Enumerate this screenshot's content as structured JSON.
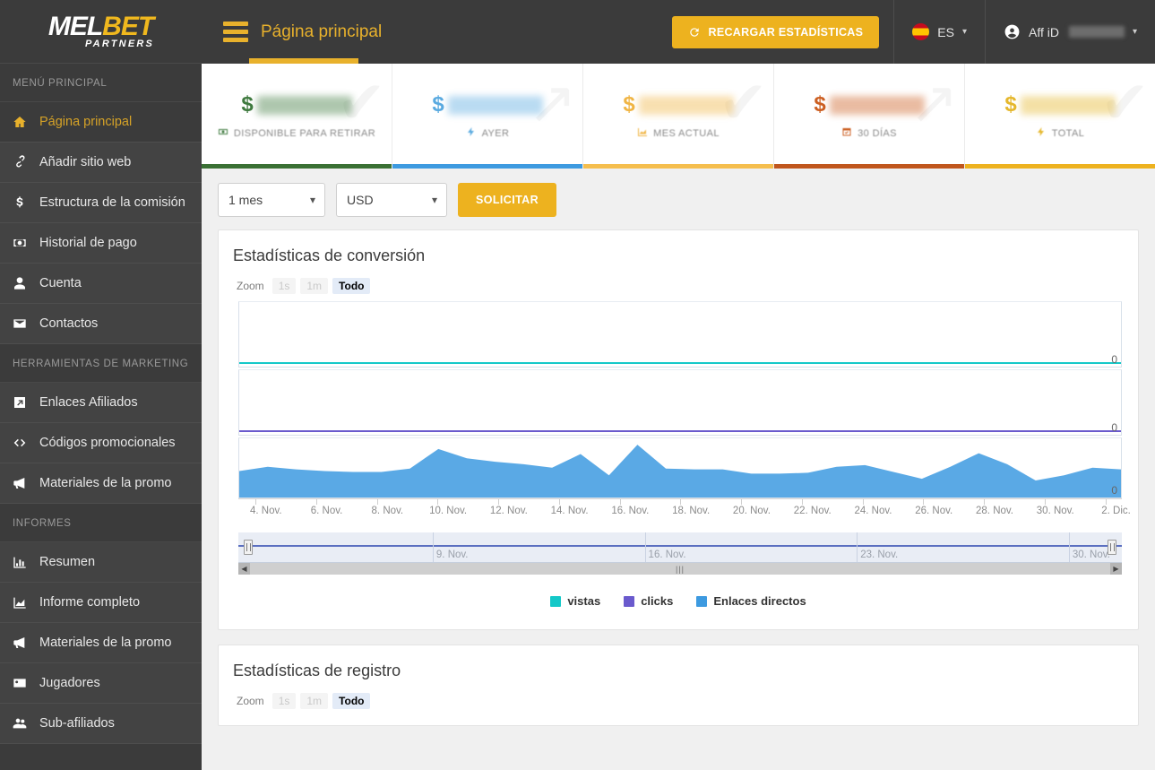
{
  "brand": {
    "logo_main_light": "MEL",
    "logo_main_accent": "BET",
    "logo_sub": "PARTNERS",
    "accent": "#e8b12c"
  },
  "sidebar": {
    "sections": [
      {
        "heading": "MENÚ PRINCIPAL",
        "items": [
          {
            "label": "Página principal",
            "icon": "home-icon",
            "active": true
          },
          {
            "label": "Añadir sitio web",
            "icon": "link-icon",
            "active": false
          },
          {
            "label": "Estructura de la comisión",
            "icon": "dollar-icon",
            "active": false
          },
          {
            "label": "Historial de pago",
            "icon": "money-icon",
            "active": false
          },
          {
            "label": "Cuenta",
            "icon": "user-icon",
            "active": false
          },
          {
            "label": "Contactos",
            "icon": "envelope-icon",
            "active": false
          }
        ]
      },
      {
        "heading": "HERRAMIENTAS DE MARKETING",
        "items": [
          {
            "label": "Enlaces Afiliados",
            "icon": "external-link-icon",
            "active": false
          },
          {
            "label": "Códigos promocionales",
            "icon": "code-icon",
            "active": false
          },
          {
            "label": "Materiales de la promo",
            "icon": "megaphone-icon",
            "active": false
          }
        ]
      },
      {
        "heading": "INFORMES",
        "items": [
          {
            "label": "Resumen",
            "icon": "bar-chart-icon",
            "active": false
          },
          {
            "label": "Informe completo",
            "icon": "area-chart-icon",
            "active": false
          },
          {
            "label": "Materiales de la promo",
            "icon": "megaphone-icon",
            "active": false
          },
          {
            "label": "Jugadores",
            "icon": "id-card-icon",
            "active": false
          },
          {
            "label": "Sub-afiliados",
            "icon": "users-icon",
            "active": false
          }
        ]
      }
    ]
  },
  "topbar": {
    "title": "Página principal",
    "reload_label": "RECARGAR ESTADÍSTICAS",
    "language": "ES",
    "account_label": "Aff iD",
    "account_value_redacted": true
  },
  "cards": [
    {
      "currency": "$",
      "value_redacted": true,
      "label": "DISPONIBLE PARA RETIRAR",
      "icon": "money-bill-icon",
      "color": "#3f7a3f",
      "bar": "#3a7034"
    },
    {
      "currency": "$",
      "value_redacted": true,
      "label": "AYER",
      "icon": "bolt-icon",
      "color": "#5aaae0",
      "bar": "#3d9ae0"
    },
    {
      "currency": "$",
      "value_redacted": true,
      "label": "MES ACTUAL",
      "icon": "chart-icon",
      "color": "#f0b545",
      "bar": "#f5be4e"
    },
    {
      "currency": "$",
      "value_redacted": true,
      "label": "30 DÍAS",
      "icon": "calendar-check-icon",
      "color": "#cc5f22",
      "bar": "#c0561d"
    },
    {
      "currency": "$",
      "value_redacted": true,
      "label": "TOTAL",
      "icon": "bolt-icon",
      "color": "#e5b72c",
      "bar": "#edb21f"
    }
  ],
  "filters": {
    "period": {
      "value": "1 mes",
      "options": [
        "1 mes"
      ]
    },
    "currency": {
      "value": "USD",
      "options": [
        "USD"
      ]
    },
    "submit_label": "SOLICITAR"
  },
  "panels": [
    {
      "title": "Estadísticas de conversión",
      "zoom": {
        "label": "Zoom",
        "buttons": [
          {
            "label": "1s",
            "selected": false
          },
          {
            "label": "1m",
            "selected": false
          },
          {
            "label": "Todo",
            "selected": true
          }
        ]
      }
    },
    {
      "title": "Estadísticas de registro",
      "zoom": {
        "label": "Zoom",
        "buttons": [
          {
            "label": "1s",
            "selected": false
          },
          {
            "label": "1m",
            "selected": false
          },
          {
            "label": "Todo",
            "selected": true
          }
        ]
      }
    }
  ],
  "legend": [
    {
      "label": "vistas",
      "color": "#14c8c8"
    },
    {
      "label": "clicks",
      "color": "#6a5acd"
    },
    {
      "label": "Enlaces directos",
      "color": "#3d9ae0"
    }
  ],
  "navigator": {
    "labels": [
      "9. Nov.",
      "16. Nov.",
      "23. Nov.",
      "30. Nov."
    ],
    "left_arrow": "◀",
    "right_arrow": "▶"
  },
  "chart_data": {
    "type": "area",
    "title": "Estadísticas de conversión",
    "xlabel": "",
    "ylabel": "",
    "grid": true,
    "legend_position": "bottom",
    "x_tick_labels": [
      "4. Nov.",
      "6. Nov.",
      "8. Nov.",
      "10. Nov.",
      "12. Nov.",
      "14. Nov.",
      "16. Nov.",
      "18. Nov.",
      "20. Nov.",
      "22. Nov.",
      "24. Nov.",
      "26. Nov.",
      "28. Nov.",
      "30. Nov.",
      "2. Dic."
    ],
    "y_axis_labels": [
      "0",
      "0",
      "0"
    ],
    "ylim": [
      0,
      1
    ],
    "panels": [
      {
        "name": "vistas",
        "color": "#14c8c8",
        "values_flat_at": 0,
        "note": "flat line at baseline"
      },
      {
        "name": "clicks",
        "color": "#6a5acd",
        "values_flat_at": 0,
        "note": "flat line at baseline"
      },
      {
        "name": "Enlaces directos",
        "color": "#3d9ae0",
        "note": "filled area series"
      }
    ],
    "x": [
      "3. Nov.",
      "4. Nov.",
      "5. Nov.",
      "6. Nov.",
      "7. Nov.",
      "8. Nov.",
      "9. Nov.",
      "10. Nov.",
      "11. Nov.",
      "12. Nov.",
      "13. Nov.",
      "14. Nov.",
      "15. Nov.",
      "16. Nov.",
      "17. Nov.",
      "18. Nov.",
      "19. Nov.",
      "20. Nov.",
      "21. Nov.",
      "22. Nov.",
      "23. Nov.",
      "24. Nov.",
      "25. Nov.",
      "26. Nov.",
      "27. Nov.",
      "28. Nov.",
      "29. Nov.",
      "30. Nov.",
      "1. Dic.",
      "2. Dic."
    ],
    "series": [
      {
        "name": "vistas",
        "color": "#14c8c8",
        "values": [
          0,
          0,
          0,
          0,
          0,
          0,
          0,
          0,
          0,
          0,
          0,
          0,
          0,
          0,
          0,
          0,
          0,
          0,
          0,
          0,
          0,
          0,
          0,
          0,
          0,
          0,
          0,
          0,
          0,
          0
        ]
      },
      {
        "name": "clicks",
        "color": "#6a5acd",
        "values": [
          0,
          0,
          0,
          0,
          0,
          0,
          0,
          0,
          0,
          0,
          0,
          0,
          0,
          0,
          0,
          0,
          0,
          0,
          0,
          0,
          0,
          0,
          0,
          0,
          0,
          0,
          0,
          0,
          0,
          0
        ]
      },
      {
        "name": "Enlaces directos",
        "color": "#3d9ae0",
        "values": [
          31,
          36,
          33,
          31,
          30,
          30,
          34,
          57,
          46,
          42,
          39,
          35,
          51,
          26,
          62,
          34,
          33,
          33,
          28,
          28,
          29,
          36,
          38,
          30,
          22,
          36,
          52,
          39,
          20,
          26,
          35,
          33
        ]
      }
    ]
  }
}
